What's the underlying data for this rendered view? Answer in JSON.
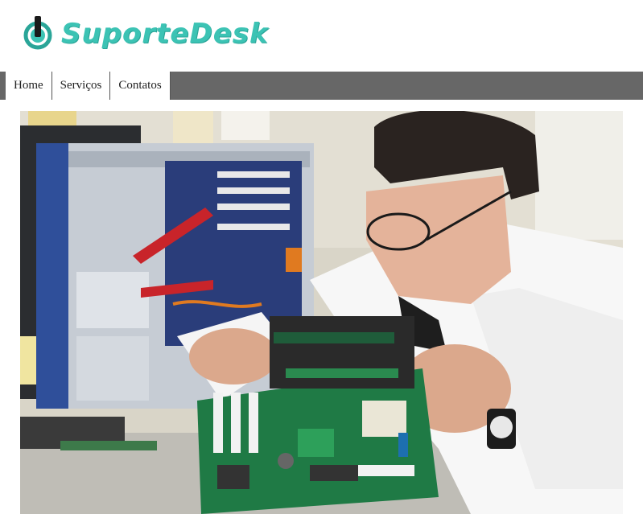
{
  "brand": {
    "name": "SuporteDesk",
    "primary_color": "#3cc3b4",
    "icon": "power-icon"
  },
  "nav": {
    "items": [
      {
        "label": "Home"
      },
      {
        "label": "Serviços"
      },
      {
        "label": "Contatos"
      }
    ],
    "bar_color": "#676767"
  },
  "hero": {
    "image": "technician-repairing-computer-motherboard"
  }
}
